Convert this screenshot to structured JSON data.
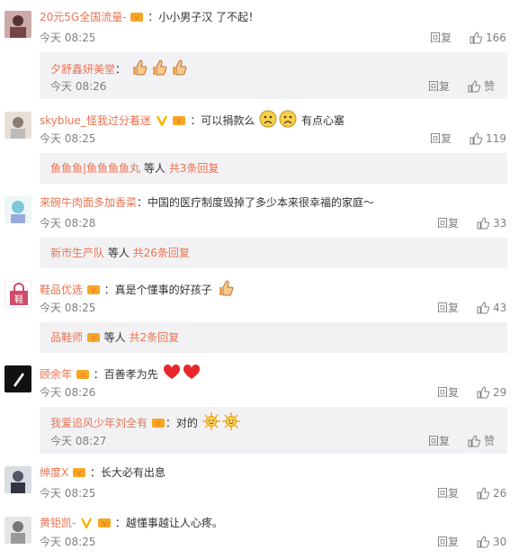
{
  "comments": [
    {
      "user": "20元5G全国流量-",
      "text": "：小小男子汉 了不起！",
      "time": "今天 08:25",
      "reply": "回复",
      "likes": "166",
      "sub": {
        "user": "夕舒鑫妍美堂",
        "text": "：",
        "emojis": [
          "thumbs-up",
          "thumbs-up",
          "thumbs-up"
        ],
        "time": "今天 08:26",
        "reply": "回复",
        "likes": "赞"
      }
    },
    {
      "user": "skyblue_怪我过分着迷",
      "text": "：可以捐款么",
      "text_after": "有点心塞",
      "time": "今天 08:25",
      "reply": "回复",
      "likes": "119",
      "more": {
        "users": "鱼鱼鱼|鱼鱼鱼鱼丸",
        "middle": " 等人 ",
        "count": "共3条回复"
      }
    },
    {
      "user": "来碗牛肉面多加香菜",
      "text": "：中国的医疗制度毁掉了多少本来很幸福的家庭～",
      "time": "今天 08:28",
      "reply": "回复",
      "likes": "33",
      "more": {
        "users": "新市生产队",
        "middle": " 等人 ",
        "count": "共26条回复"
      }
    },
    {
      "user": "鞋品优选",
      "text": "：真是个懂事的好孩子",
      "time": "今天 08:25",
      "reply": "回复",
      "likes": "43",
      "more": {
        "users": "品鞋师",
        "middle": " 等人 ",
        "count": "共2条回复"
      }
    },
    {
      "user": "顾余年",
      "text": "：百善孝为先",
      "time": "今天 08:26",
      "reply": "回复",
      "likes": "29",
      "sub": {
        "user": "我爱追风少年刘全有",
        "text": "：对的",
        "emojis": [
          "sun",
          "sun"
        ],
        "time": "今天 08:27",
        "reply": "回复",
        "likes": "赞"
      }
    },
    {
      "user": "绅度X",
      "text": "：长大必有出息",
      "time": "今天 08:25",
      "reply": "回复",
      "likes": "26"
    },
    {
      "user": "黄钜凯-",
      "text": "：越懂事越让人心疼。",
      "time": "今天 08:25",
      "reply": "回复",
      "likes": "30"
    }
  ],
  "avatar4_text": "鞋",
  "colors": {
    "accent": "#eb7350",
    "muted": "#808080",
    "subbox": "#f2f2f5"
  }
}
